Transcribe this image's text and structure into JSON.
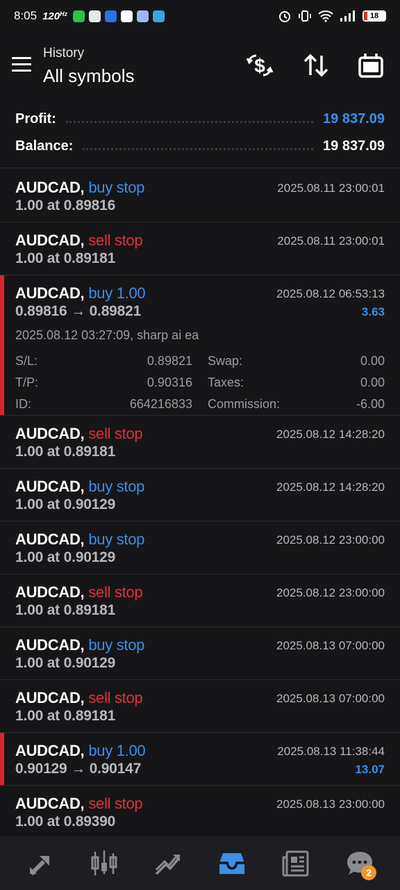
{
  "status_bar": {
    "time": "8:05",
    "refresh": "120",
    "battery": "18"
  },
  "header": {
    "subtitle": "History",
    "title": "All symbols"
  },
  "summary": {
    "profit_label": "Profit:",
    "profit_value": "19 837.09",
    "balance_label": "Balance:",
    "balance_value": "19 837.09"
  },
  "deals": [
    {
      "symbol": "AUDCAD,",
      "type": "buy stop",
      "side": "buy",
      "line2": "1.00 at 0.89816",
      "datetime": "2025.08.11 23:00:01",
      "profit": "",
      "marked": false
    },
    {
      "symbol": "AUDCAD,",
      "type": "sell stop",
      "side": "sell",
      "line2": "1.00 at 0.89181",
      "datetime": "2025.08.11 23:00:01",
      "profit": "",
      "marked": false
    },
    {
      "symbol": "AUDCAD,",
      "type": "buy 1.00",
      "side": "buy",
      "line2": "0.89816 → 0.89821",
      "datetime": "2025.08.12 06:53:13",
      "profit": "3.63",
      "marked": true,
      "details": {
        "open_info": "2025.08.12 03:27:09, sharp ai ea",
        "sl_label": "S/L:",
        "sl_value": "0.89821",
        "swap_label": "Swap:",
        "swap_value": "0.00",
        "tp_label": "T/P:",
        "tp_value": "0.90316",
        "taxes_label": "Taxes:",
        "taxes_value": "0.00",
        "id_label": "ID:",
        "id_value": "664216833",
        "commission_label": "Commission:",
        "commission_value": "-6.00"
      }
    },
    {
      "symbol": "AUDCAD,",
      "type": "sell stop",
      "side": "sell",
      "line2": "1.00 at 0.89181",
      "datetime": "2025.08.12 14:28:20",
      "profit": "",
      "marked": false
    },
    {
      "symbol": "AUDCAD,",
      "type": "buy stop",
      "side": "buy",
      "line2": "1.00 at 0.90129",
      "datetime": "2025.08.12 14:28:20",
      "profit": "",
      "marked": false
    },
    {
      "symbol": "AUDCAD,",
      "type": "buy stop",
      "side": "buy",
      "line2": "1.00 at 0.90129",
      "datetime": "2025.08.12 23:00:00",
      "profit": "",
      "marked": false
    },
    {
      "symbol": "AUDCAD,",
      "type": "sell stop",
      "side": "sell",
      "line2": "1.00 at 0.89181",
      "datetime": "2025.08.12 23:00:00",
      "profit": "",
      "marked": false
    },
    {
      "symbol": "AUDCAD,",
      "type": "buy stop",
      "side": "buy",
      "line2": "1.00 at 0.90129",
      "datetime": "2025.08.13 07:00:00",
      "profit": "",
      "marked": false
    },
    {
      "symbol": "AUDCAD,",
      "type": "sell stop",
      "side": "sell",
      "line2": "1.00 at 0.89181",
      "datetime": "2025.08.13 07:00:00",
      "profit": "",
      "marked": false
    },
    {
      "symbol": "AUDCAD,",
      "type": "buy 1.00",
      "side": "buy",
      "line2": "0.90129 → 0.90147",
      "datetime": "2025.08.13 11:38:44",
      "profit": "13.07",
      "marked": true
    },
    {
      "symbol": "AUDCAD,",
      "type": "sell stop",
      "side": "sell",
      "line2": "1.00 at 0.89390",
      "datetime": "2025.08.13 23:00:00",
      "profit": "",
      "marked": false
    }
  ],
  "bottom_nav": {
    "items": [
      {
        "icon": "quotes-icon",
        "active": false
      },
      {
        "icon": "chart-icon",
        "active": false
      },
      {
        "icon": "trade-icon",
        "active": false
      },
      {
        "icon": "history-icon",
        "active": true
      },
      {
        "icon": "news-icon",
        "active": false
      },
      {
        "icon": "messages-icon",
        "active": false,
        "badge": "2"
      }
    ]
  },
  "colors": {
    "background": "#161618",
    "accent_blue": "#3d8ee8",
    "sell_red": "#e0313b",
    "marker_red": "#d32630",
    "badge_orange": "#f0962c"
  }
}
